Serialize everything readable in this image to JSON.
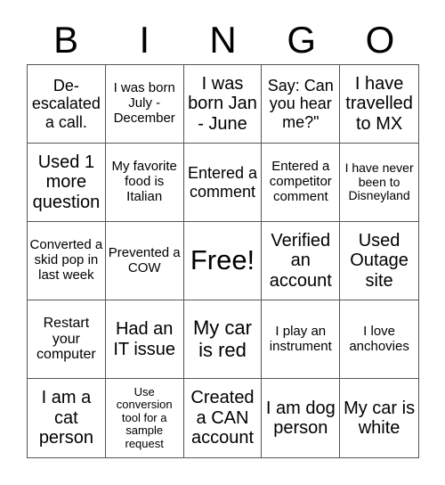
{
  "header": {
    "letters": [
      "B",
      "I",
      "N",
      "G",
      "O"
    ]
  },
  "cells": [
    "De-escalated a call.",
    "I was born July - December",
    "I was born Jan - June",
    "Say: Can you hear me?\"",
    "I have travelled to MX",
    "Used 1 more question",
    "My favorite food is Italian",
    "Entered a comment",
    "Entered a competitor comment",
    "I have never been to Disneyland",
    "Converted a skid pop in last week",
    "Prevented a COW",
    "Free!",
    "Verified an account",
    "Used Outage site",
    "Restart your computer",
    "Had an IT issue",
    "My car is red",
    "I play an instrument",
    "I love anchovies",
    "I am a cat person",
    "Use conversion tool for a sample request",
    "Created a CAN account",
    "I am dog person",
    "My car is white"
  ]
}
